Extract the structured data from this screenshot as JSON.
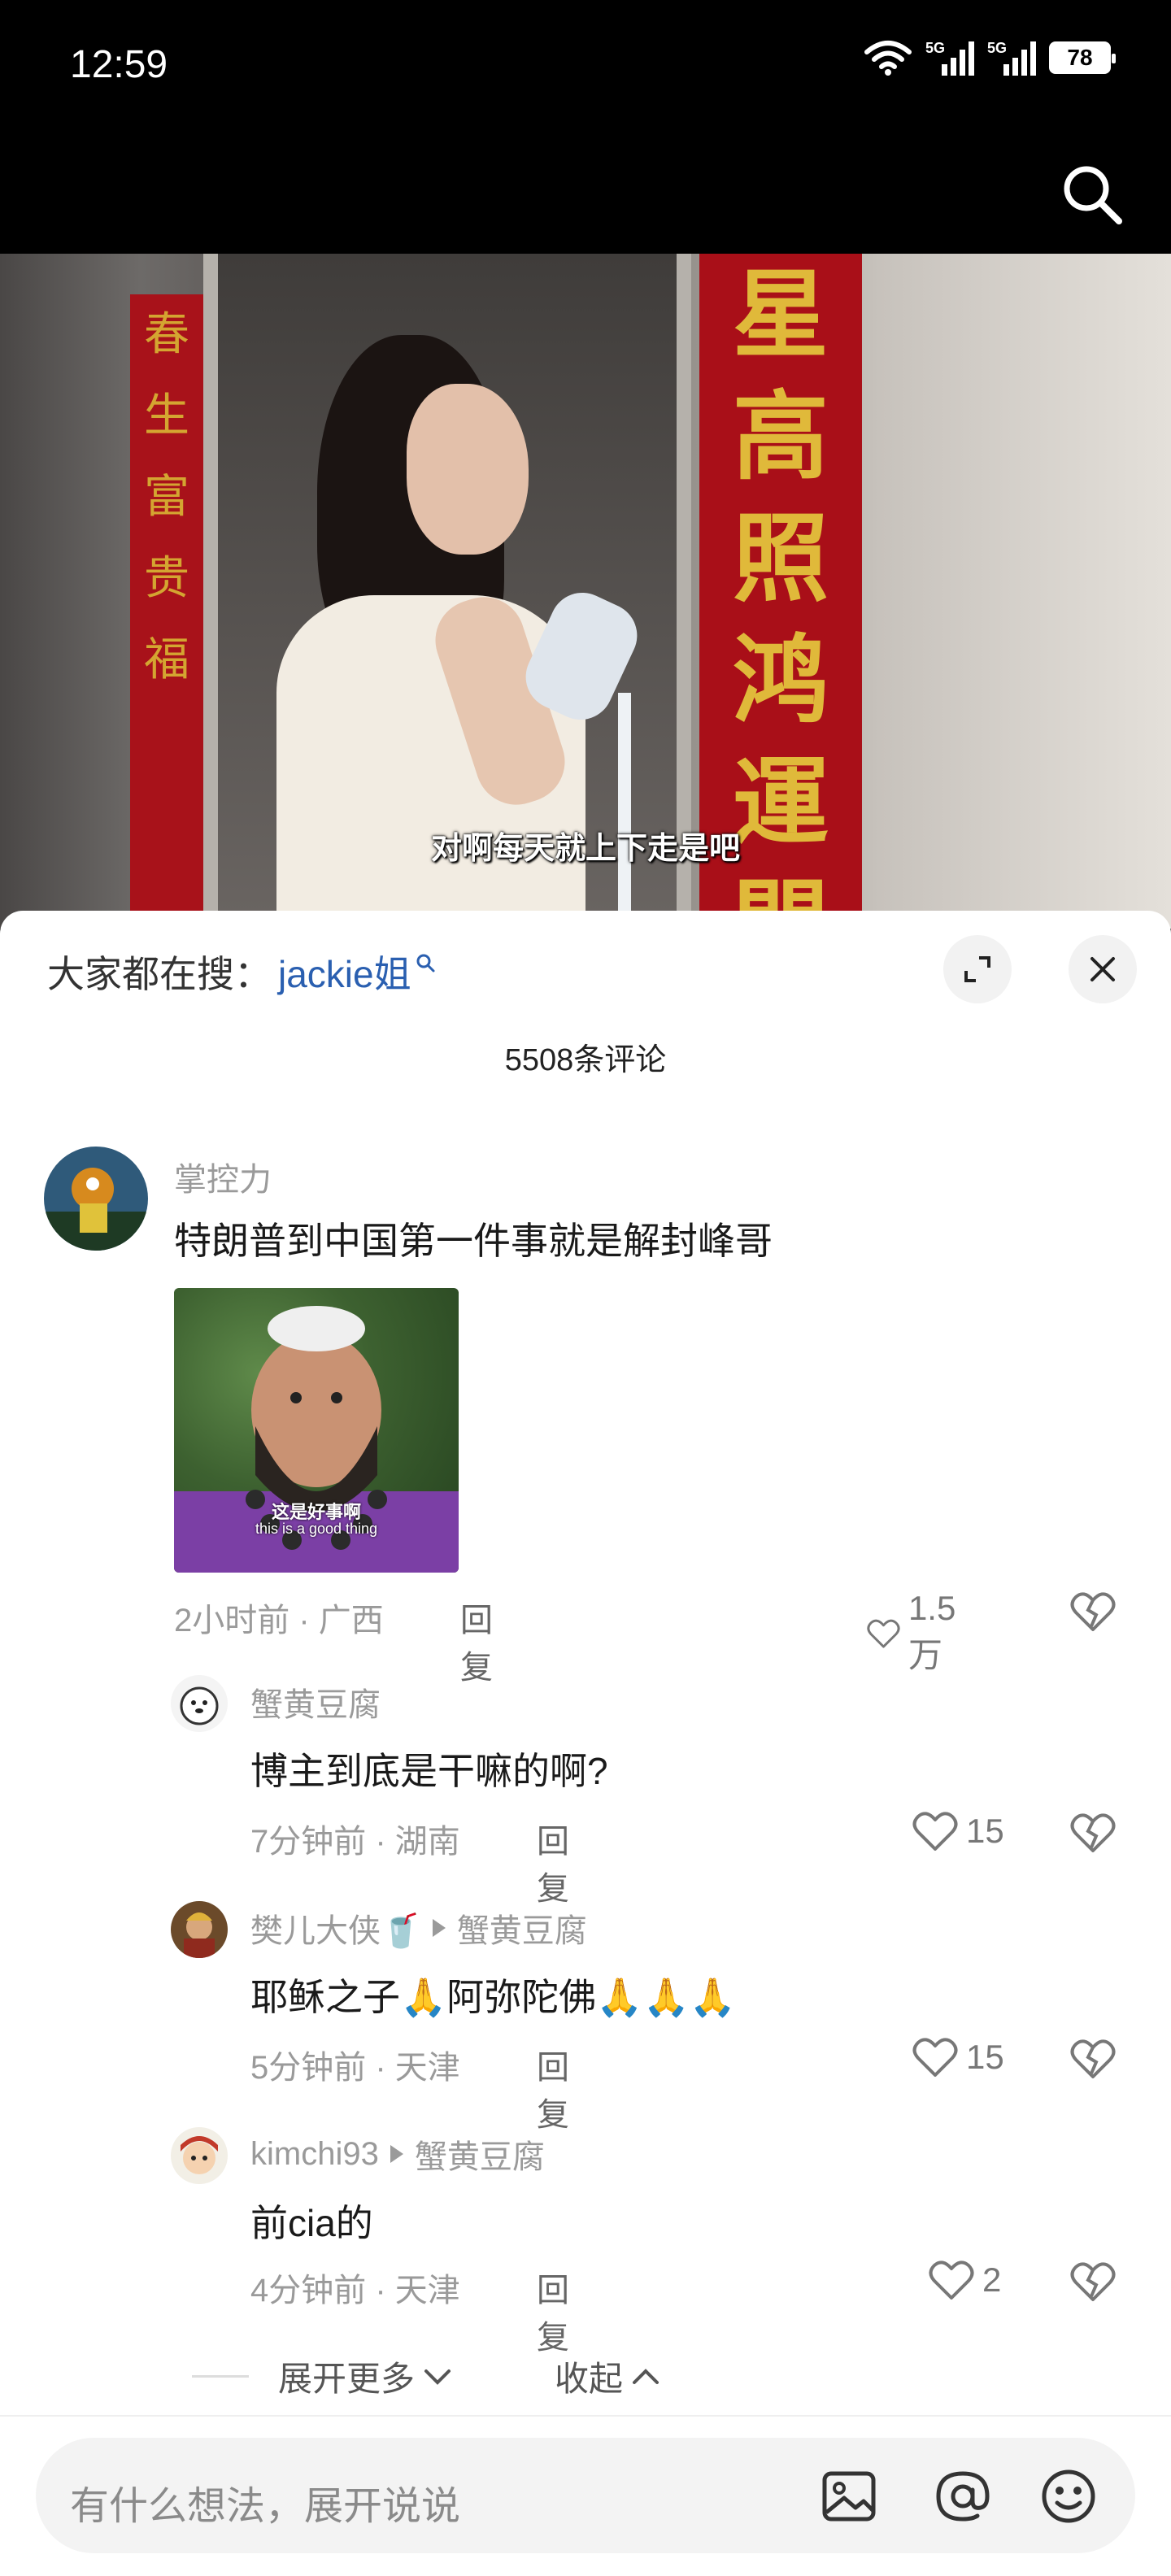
{
  "status_bar": {
    "time": "12:59",
    "signal1_label": "5G",
    "signal2_label": "5G",
    "battery": "78"
  },
  "video": {
    "subtitle": "对啊每天就上下走是吧",
    "couplet_left": [
      "春",
      "生",
      "富",
      "贵",
      "福"
    ],
    "couplet_right": [
      "星",
      "高",
      "照",
      "鸿",
      "運",
      "開"
    ]
  },
  "sheet": {
    "hot_search_label": "大家都在搜：",
    "hot_search_keyword": "jackie姐",
    "comment_count": "5508条评论"
  },
  "comments": [
    {
      "user": "掌控力",
      "text": "特朗普到中国第一件事就是解封峰哥",
      "image_caption_cn": "这是好事啊",
      "image_caption_en": "this is a good thing",
      "time": "2小时前 · 广西",
      "reply_label": "回复",
      "likes": "1.5万"
    }
  ],
  "replies": [
    {
      "user": "蟹黄豆腐",
      "reply_to": "",
      "text": "博主到底是干嘛的啊?",
      "time": "7分钟前 · 湖南",
      "reply_label": "回复",
      "likes": "15"
    },
    {
      "user": "樊儿大侠🥤",
      "reply_to": "蟹黄豆腐",
      "text": "耶稣之子🙏阿弥陀佛🙏🙏🙏",
      "time": "5分钟前 · 天津",
      "reply_label": "回复",
      "likes": "15"
    },
    {
      "user": "kimchi93",
      "reply_to": "蟹黄豆腐",
      "text": "前cia的",
      "time": "4分钟前 · 天津",
      "reply_label": "回复",
      "likes": "2"
    }
  ],
  "thread_controls": {
    "expand_more": "展开更多",
    "collapse": "收起"
  },
  "input": {
    "placeholder": "有什么想法，展开说说"
  },
  "colors": {
    "keyword": "#2a5fb0",
    "meta": "#9a9a9a",
    "text": "#1a1a1a"
  }
}
